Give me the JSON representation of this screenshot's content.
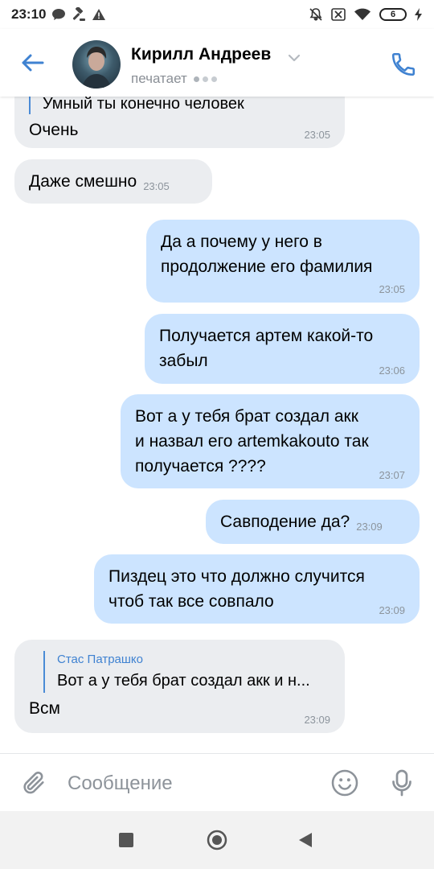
{
  "status_bar": {
    "time": "23:10",
    "left_icons": [
      "chat-bubble-icon",
      "gavel-icon",
      "warning-icon"
    ],
    "right_icons": [
      "mute-bell-icon",
      "sim-disabled-icon",
      "wifi-icon",
      "battery-icon",
      "charging-icon"
    ],
    "battery_level": "6"
  },
  "header": {
    "contact_name": "Кирилл Андреев",
    "status": "печатает"
  },
  "messages": [
    {
      "direction": "in",
      "quoted_partial": "Умный ты конечно человек",
      "text": "Очень",
      "time": "23:05"
    },
    {
      "direction": "in",
      "text": "Даже смешно",
      "time": "23:05"
    },
    {
      "direction": "out",
      "lines": [
        "Да а почему у него в",
        "продолжение его фамилия"
      ],
      "time": "23:05"
    },
    {
      "direction": "out",
      "lines": [
        "Получается артем какой-то",
        "забыл"
      ],
      "time": "23:06"
    },
    {
      "direction": "out",
      "lines": [
        "Вот а у тебя брат создал акк",
        "и назвал его artemkakouto так",
        "получается ????"
      ],
      "time": "23:07"
    },
    {
      "direction": "out",
      "text": "Савподение да?",
      "time": "23:09"
    },
    {
      "direction": "out",
      "lines": [
        "Пиздец это что должно случится",
        "чтоб так все совпало"
      ],
      "time": "23:09"
    },
    {
      "direction": "in",
      "reply_author": "Стас Патрашко",
      "reply_text": "Вот а у тебя брат создал акк и н...",
      "text": "Всм",
      "time": "23:09"
    }
  ],
  "composer": {
    "placeholder": "Сообщение"
  },
  "colors": {
    "accent": "#3f82d1",
    "bubble_in": "#ebedf0",
    "bubble_out": "#cce4ff",
    "time_text": "#8c949c"
  }
}
